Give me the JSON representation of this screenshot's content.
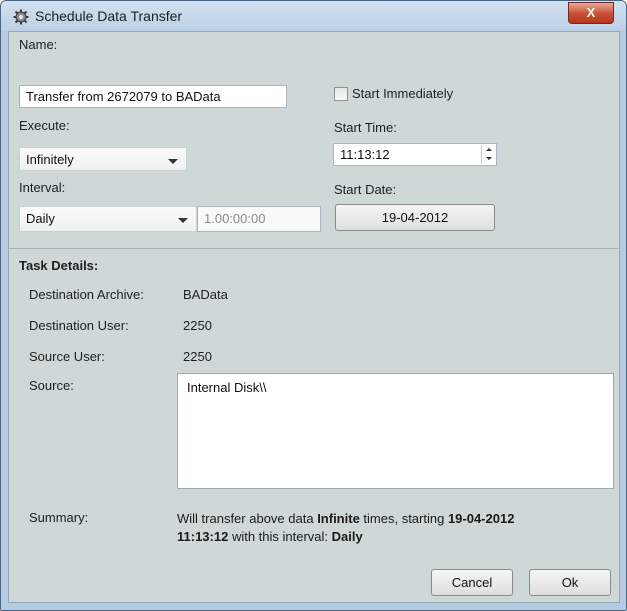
{
  "window": {
    "title": "Schedule Data Transfer",
    "close_label": "X"
  },
  "form": {
    "name_label": "Name:",
    "name_value": "Transfer from 2672079 to BAData",
    "start_immediately_label": "Start Immediately",
    "start_immediately_checked": false,
    "execute_label": "Execute:",
    "execute_value": "Infinitely",
    "start_time_label": "Start Time:",
    "start_time_value": "11:13:12",
    "interval_label": "Interval:",
    "interval_value": "Daily",
    "interval_duration": "1.00:00:00",
    "start_date_label": "Start Date:",
    "start_date_value": "19-04-2012"
  },
  "details": {
    "heading": "Task Details:",
    "destination_archive_label": "Destination Archive:",
    "destination_archive_value": "BAData",
    "destination_user_label": "Destination User:",
    "destination_user_value": "2250",
    "source_user_label": "Source User:",
    "source_user_value": "2250",
    "source_label": "Source:",
    "source_value": "Internal Disk\\\\",
    "summary_label": "Summary:",
    "summary": {
      "part1": "Will transfer above data ",
      "times": "Infinite",
      "part2": " times, starting ",
      "date": "19-04-2012",
      "time": "11:13:12",
      "part3": " with this interval: ",
      "interval": "Daily"
    }
  },
  "buttons": {
    "cancel": "Cancel",
    "ok": "Ok"
  }
}
